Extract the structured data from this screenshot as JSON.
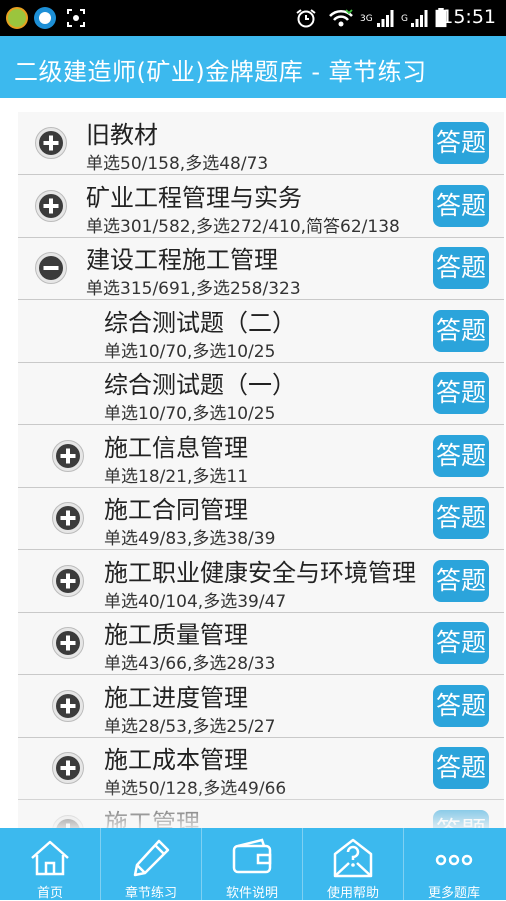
{
  "status_bar": {
    "time": "15:51",
    "network_3g": "3G",
    "network_g": "G",
    "icons": [
      "app-icon-green",
      "app-icon-q",
      "screenshot-icon",
      "alarm-icon",
      "wifi-icon",
      "signal-icon",
      "signal-icon",
      "battery-icon"
    ]
  },
  "header": {
    "title": "二级建造师(矿业)金牌题库  -  章节练习"
  },
  "answer_label": "答题",
  "rows": [
    {
      "title": "旧教材",
      "stats": "单选50/158,多选48/73",
      "icon": "plus-circle-icon",
      "level": 0
    },
    {
      "title": "矿业工程管理与实务",
      "stats": "单选301/582,多选272/410,简答62/138",
      "icon": "plus-circle-icon",
      "level": 0
    },
    {
      "title": "建设工程施工管理",
      "stats": "单选315/691,多选258/323",
      "icon": "minus-circle-icon",
      "level": 0
    },
    {
      "title": "综合测试题（二）",
      "stats": "单选10/70,多选10/25",
      "icon": "",
      "level": 1
    },
    {
      "title": "综合测试题（一）",
      "stats": "单选10/70,多选10/25",
      "icon": "",
      "level": 1
    },
    {
      "title": "施工信息管理",
      "stats": "单选18/21,多选11",
      "icon": "plus-circle-icon",
      "level": 1
    },
    {
      "title": "施工合同管理",
      "stats": "单选49/83,多选38/39",
      "icon": "plus-circle-icon",
      "level": 1
    },
    {
      "title": "施工职业健康安全与环境管理",
      "stats": "单选40/104,多选39/47",
      "icon": "plus-circle-icon",
      "level": 1
    },
    {
      "title": "施工质量管理",
      "stats": "单选43/66,多选28/33",
      "icon": "plus-circle-icon",
      "level": 1
    },
    {
      "title": "施工进度管理",
      "stats": "单选28/53,多选25/27",
      "icon": "plus-circle-icon",
      "level": 1
    },
    {
      "title": "施工成本管理",
      "stats": "单选50/128,多选49/66",
      "icon": "plus-circle-icon",
      "level": 1
    },
    {
      "title": "施工管理",
      "stats": "",
      "icon": "plus-circle-icon",
      "level": 1
    }
  ],
  "bottom_nav": [
    {
      "label": "首页",
      "icon": "home-icon"
    },
    {
      "label": "章节练习",
      "icon": "pencil-icon"
    },
    {
      "label": "软件说明",
      "icon": "wallet-icon"
    },
    {
      "label": "使用帮助",
      "icon": "help-mail-icon"
    },
    {
      "label": "更多题库",
      "icon": "more-icon"
    }
  ],
  "colors": {
    "accent": "#3cb9ee",
    "button": "#2ba4db",
    "divider": "#c9c9c9"
  }
}
